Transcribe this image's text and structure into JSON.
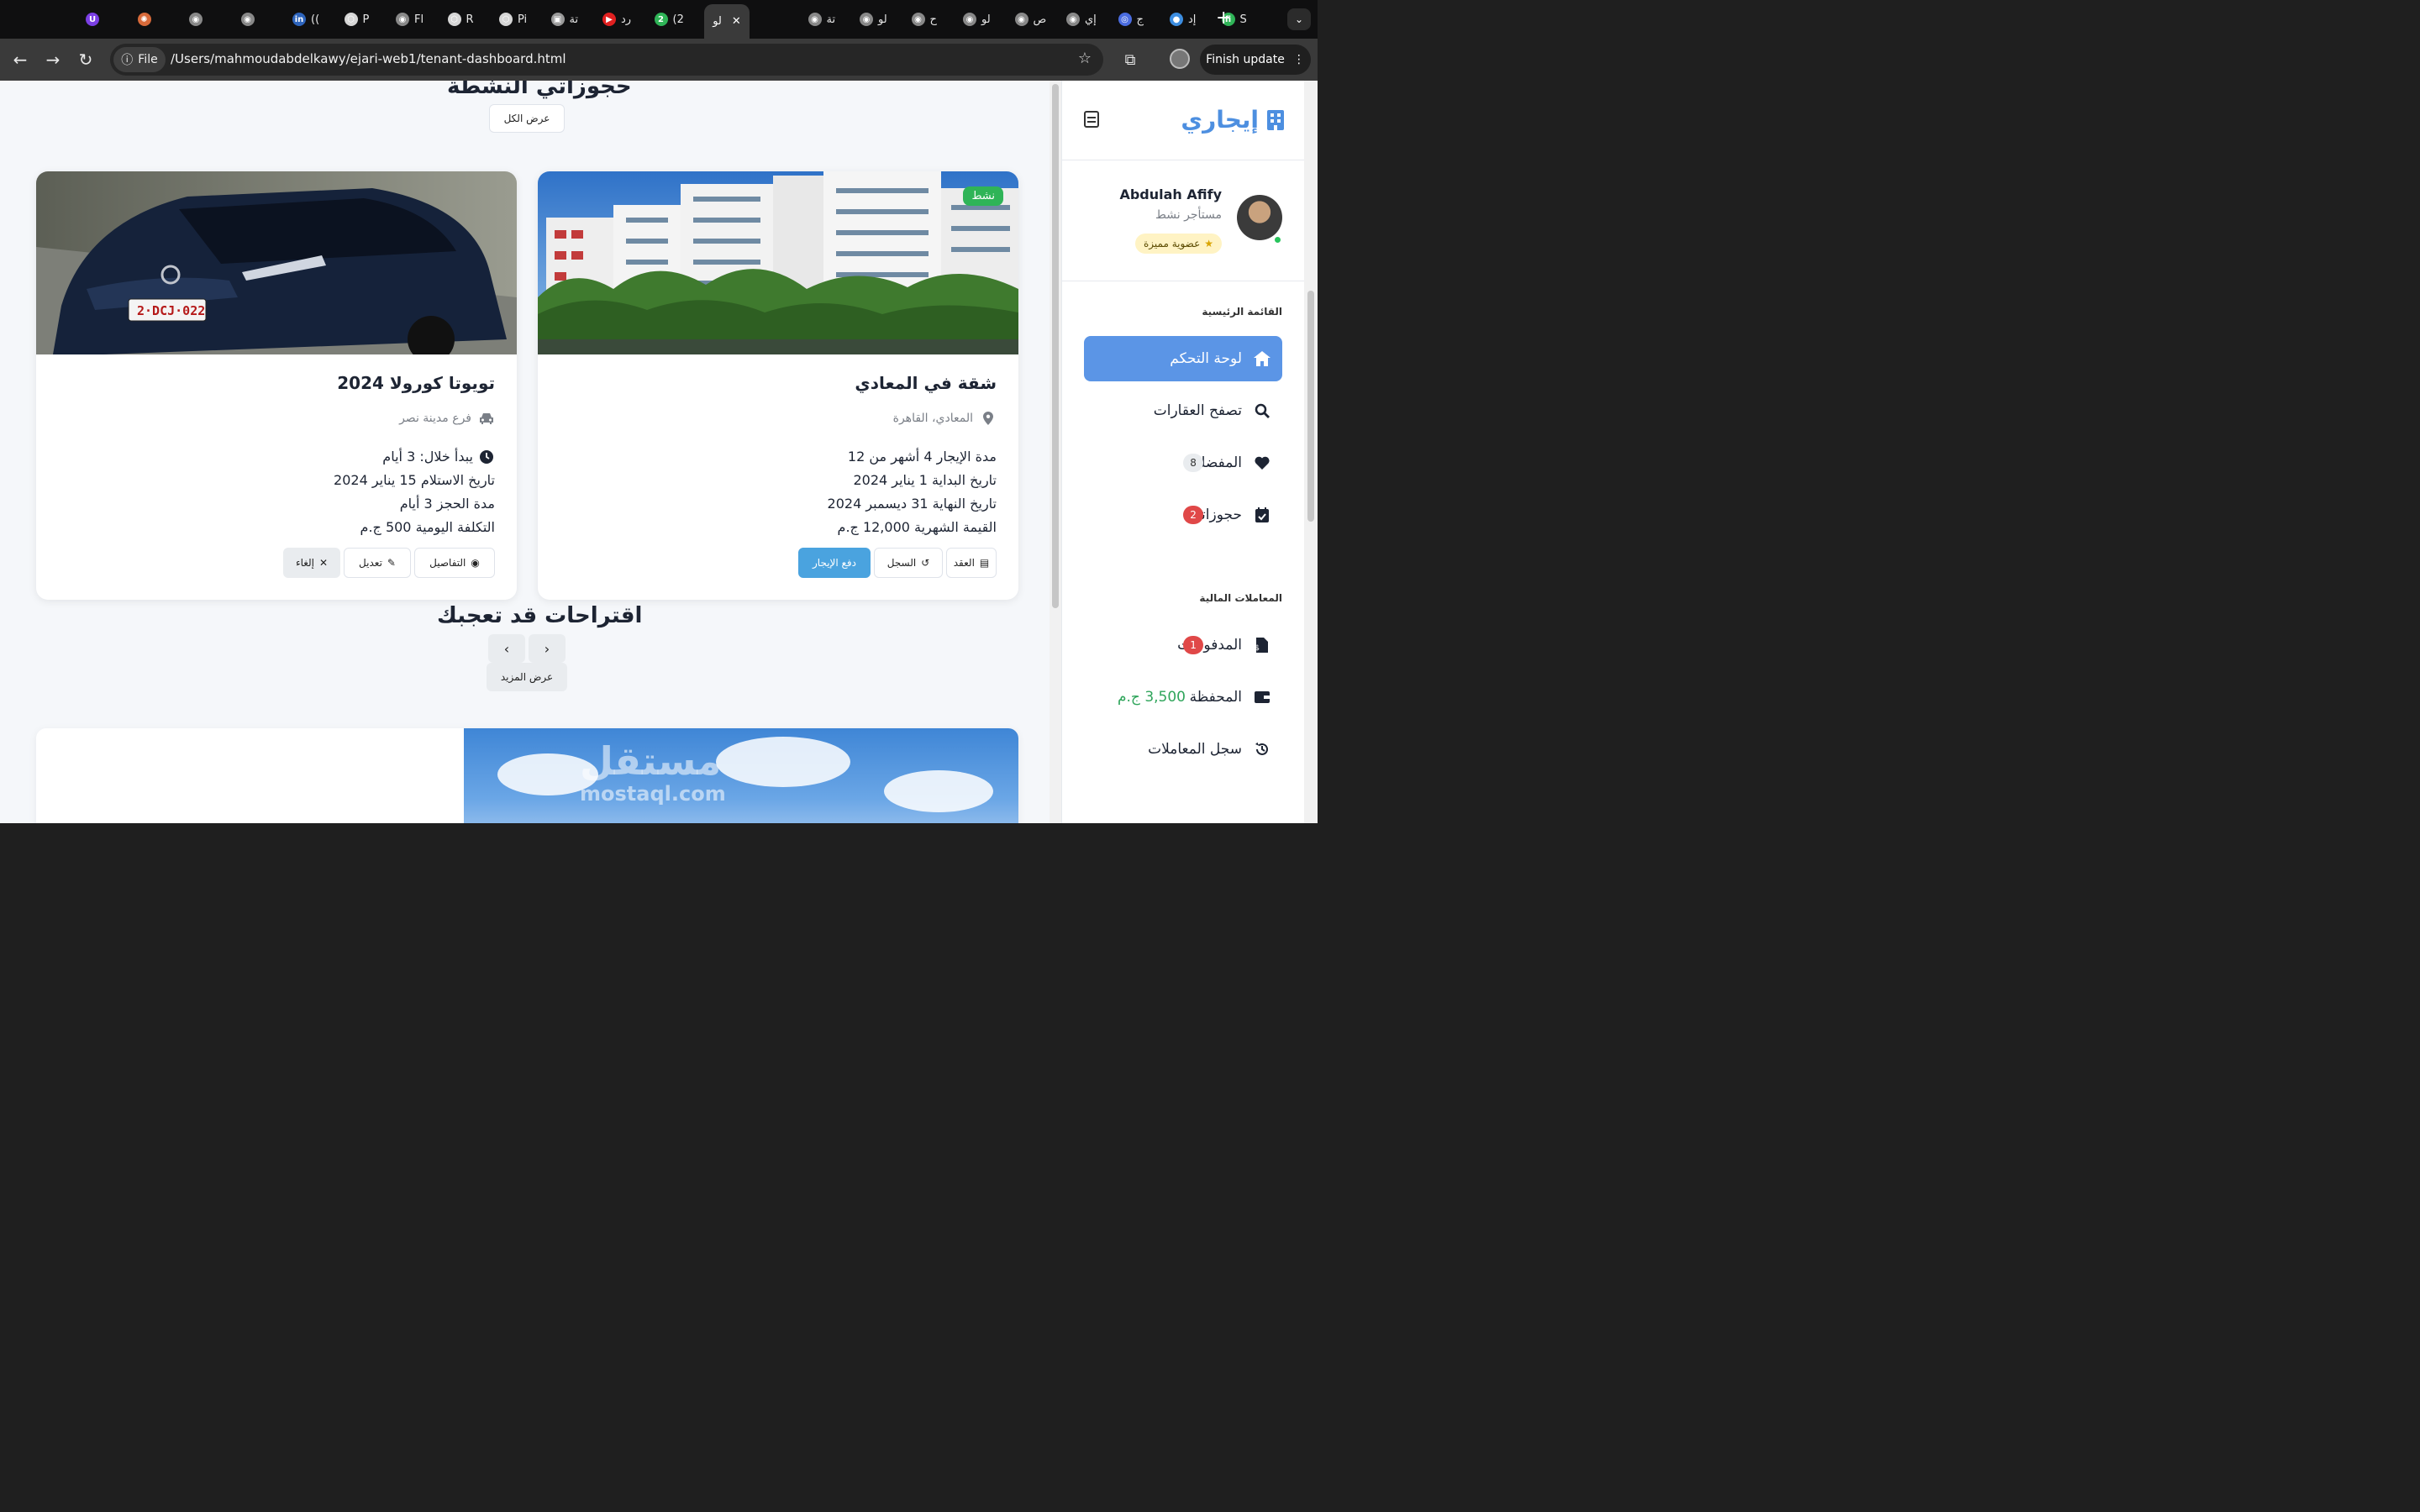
{
  "browser": {
    "tabs": [
      {
        "label": "",
        "icon": "purple-u-icon",
        "color": "#7b3fe4",
        "glyph": "U"
      },
      {
        "label": "",
        "icon": "sparkle-icon",
        "color": "#d86a3a",
        "glyph": "✺"
      },
      {
        "label": "",
        "icon": "globe-icon",
        "color": "#888888",
        "glyph": "◉"
      },
      {
        "label": "",
        "icon": "globe-icon",
        "color": "#888888",
        "glyph": "◉"
      },
      {
        "label": "((",
        "icon": "linkedin-icon",
        "color": "#2d64bc",
        "glyph": "in"
      },
      {
        "label": "P",
        "icon": "hex-icon",
        "color": "#d6d6d6",
        "glyph": "⬡"
      },
      {
        "label": "Fl",
        "icon": "globe-icon",
        "color": "#888888",
        "glyph": "◉"
      },
      {
        "label": "R",
        "icon": "hex-icon",
        "color": "#d6d6d6",
        "glyph": "⬡"
      },
      {
        "label": "Pi",
        "icon": "hex-icon",
        "color": "#d6d6d6",
        "glyph": "⬡"
      },
      {
        "label": "تة",
        "icon": "image-icon",
        "color": "#999999",
        "glyph": "▣"
      },
      {
        "label": "رد",
        "icon": "youtube-icon",
        "color": "#e02020",
        "glyph": "▶"
      },
      {
        "label": "(2",
        "icon": "whatsapp-icon",
        "color": "#2fb457",
        "glyph": "2"
      },
      {
        "label": "((",
        "icon": "linkedin-icon",
        "color": "#2d64bc",
        "glyph": "in"
      },
      {
        "label": "تة",
        "icon": "globe-icon",
        "color": "#888888",
        "glyph": "◉"
      },
      {
        "label": "لو",
        "icon": "globe-icon",
        "color": "#888888",
        "glyph": "◉"
      },
      {
        "label": "ح",
        "icon": "globe-icon",
        "color": "#888888",
        "glyph": "◉"
      },
      {
        "label": "لو",
        "icon": "globe-icon",
        "color": "#888888",
        "glyph": "◉"
      },
      {
        "label": "ص",
        "icon": "globe-icon",
        "color": "#888888",
        "glyph": "◉"
      },
      {
        "label": "إي",
        "icon": "globe-icon",
        "color": "#888888",
        "glyph": "◉"
      },
      {
        "label": "ج",
        "icon": "eye-icon",
        "color": "#4a6ce0",
        "glyph": "◎"
      },
      {
        "label": "إد",
        "icon": "circle-icon",
        "color": "#3c8de0",
        "glyph": "●"
      },
      {
        "label": "S",
        "icon": "fi-icon",
        "color": "#2fb457",
        "glyph": "fi"
      }
    ],
    "active_tab_label": "لو",
    "address_chip": "File",
    "url": "/Users/mahmoudabdelkawy/ejari-web1/tenant-dashboard.html",
    "finish_update": "Finish update"
  },
  "main": {
    "bookings_title": "حجوزاتي النشطة",
    "view_all": "عرض الكل",
    "cards": [
      {
        "title": "شقة في المعادي",
        "location": "المعادي، القاهرة",
        "status": "نشط",
        "lines": [
          "مدة الإيجار 4 أشهر من 12",
          "تاريخ البداية 1 يناير 2024",
          "تاريخ النهاية 31 ديسمبر 2024",
          "القيمة الشهرية 12,000 ج.م"
        ],
        "actions": [
          "العقد",
          "السجل",
          "دفع الإيجار"
        ]
      },
      {
        "title": "تويوتا كورولا 2024",
        "location": "فرع مدينة نصر",
        "lines": [
          "يبدأ خلال: 3 أيام",
          "تاريخ الاستلام 15 يناير 2024",
          "مدة الحجز 3 أيام",
          "التكلفة اليومية 500 ج.م"
        ],
        "actions": [
          "التفاصيل",
          "تعديل",
          "إلغاء"
        ]
      }
    ],
    "suggestions_title": "اقتراحات قد تعجبك",
    "show_more": "عرض المزيد",
    "watermark": "مستقل",
    "watermark_sub": "mostaql.com",
    "plate": "2·DCJ·022"
  },
  "sidebar": {
    "brand": "إيجاري",
    "user": {
      "name": "Abdulah Afify",
      "status": "مستأجر نشط",
      "membership": "عضوية مميزة"
    },
    "main_menu_label": "القائمة الرئيسية",
    "main_menu": [
      {
        "label": "لوحة التحكم",
        "icon": "home-icon"
      },
      {
        "label": "تصفح العقارات",
        "icon": "search-icon"
      },
      {
        "label": "المفضلة",
        "icon": "heart-icon",
        "count": "8"
      },
      {
        "label": "حجوزاتي",
        "icon": "calendar-icon",
        "count": "2"
      }
    ],
    "finance_label": "المعاملات المالية",
    "finance_menu": [
      {
        "label": "المدفوعات",
        "icon": "invoice-icon",
        "count": "1"
      },
      {
        "label": "المحفظة",
        "icon": "wallet-icon",
        "amount": "3,500 ج.م"
      },
      {
        "label": "سجل المعاملات",
        "icon": "history-icon"
      }
    ]
  },
  "colors": {
    "brand": "#4d8fe0",
    "active_nav": "#5b95e6",
    "success": "#2fb457",
    "danger": "#e04848",
    "primary_btn": "#4aa3df"
  }
}
